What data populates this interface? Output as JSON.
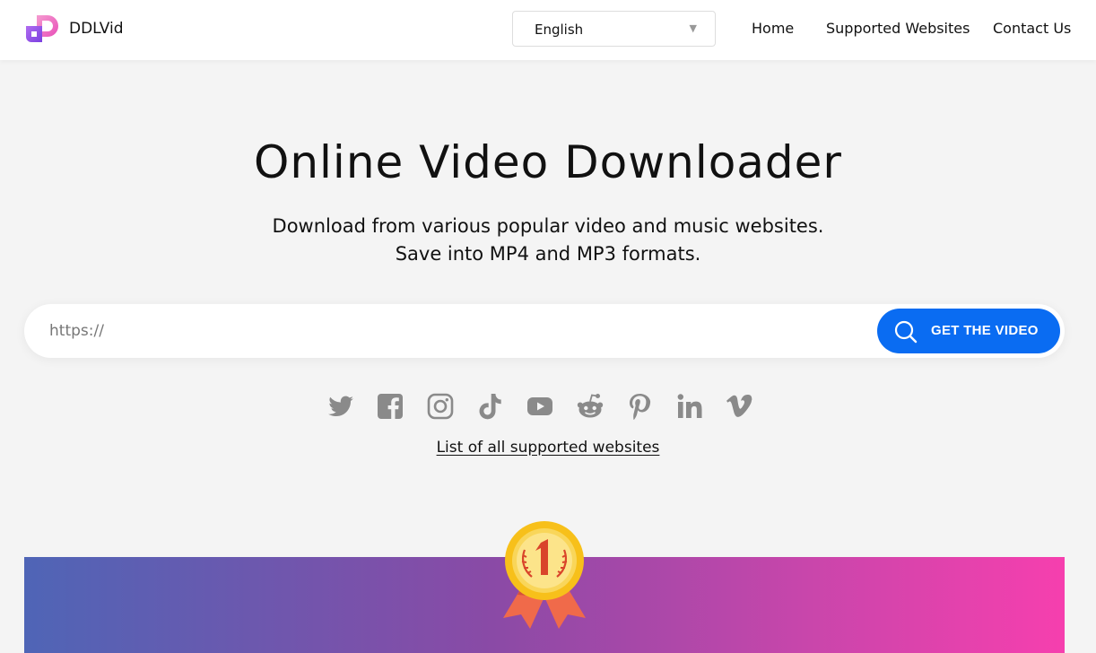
{
  "header": {
    "brand": "DDLVid",
    "language": {
      "selected": "English"
    },
    "nav": [
      {
        "label": "Home"
      },
      {
        "label": "Supported Websites"
      },
      {
        "label": "Contact Us"
      }
    ]
  },
  "hero": {
    "title": "Online Video Downloader",
    "subtitle_line1": "Download from various popular video and music websites.",
    "subtitle_line2": "Save into MP4 and MP3 formats."
  },
  "search": {
    "placeholder": "https://",
    "button_label": "GET THE VIDEO"
  },
  "socials": [
    "twitter-icon",
    "facebook-icon",
    "instagram-icon",
    "tiktok-icon",
    "youtube-icon",
    "reddit-icon",
    "pinterest-icon",
    "linkedin-icon",
    "vimeo-icon"
  ],
  "supported_link": "List of all supported websites",
  "colors": {
    "accent": "#0a6cf2",
    "icon_gray": "#8a8a8a",
    "banner_start": "#4f65b6",
    "banner_end": "#f63fae",
    "logo_pink": "#e84fb8",
    "logo_purple": "#8e4fe8"
  }
}
